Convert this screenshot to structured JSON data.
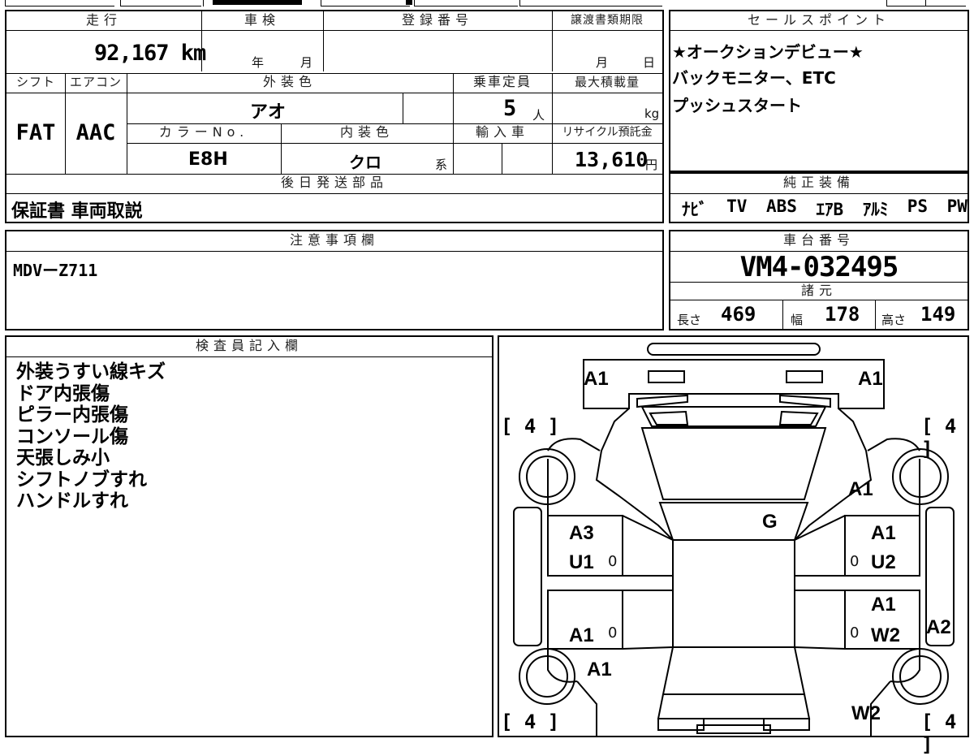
{
  "vehicle": {
    "mileage": "92,167 km",
    "inspection_year_unit": "年",
    "inspection_month_unit": "月",
    "transfer_month_unit": "月",
    "transfer_day_unit": "日",
    "shift": "FAT",
    "aircon": "AAC",
    "exterior_color": "アオ",
    "capacity": "5",
    "capacity_unit": "人",
    "max_load_unit": "kg",
    "color_no": "E8H",
    "interior_color": "クロ",
    "interior_suffix": "系",
    "recycle_fee": "13,610",
    "recycle_unit": "円",
    "chassis_no": "VM4-032495",
    "length_label": "長さ",
    "length": "469",
    "width_label": "幅",
    "width": "178",
    "height_label": "高さ",
    "height": "149"
  },
  "headers": {
    "mileage": "走行",
    "inspection": "車検",
    "registration": "登録番号",
    "transfer_deadline": "譲渡書類期限",
    "shift": "シフト",
    "aircon": "エアコン",
    "exterior_color": "外装色",
    "capacity": "乗車定員",
    "max_load": "最大積載量",
    "color_no": "カラーNo.",
    "interior_color": "内装色",
    "import": "輸入車",
    "recycle": "リサイクル預託金",
    "later_parts": "後日発送部品",
    "sales_points": "セールスポイント",
    "genuine_equipment": "純正装備",
    "notes": "注意事項欄",
    "chassis": "車台番号",
    "specs": "諸元",
    "inspector": "検査員記入欄"
  },
  "later_parts": "保証書 車両取説",
  "sales_points": [
    "★オークションデビュー★",
    "バックモニター、ETC",
    "プッシュスタート"
  ],
  "equipment": [
    "ﾅﾋﾞ",
    "TV",
    "ABS",
    "ｴｱB",
    "ｱﾙﾐ",
    "PS",
    "PW"
  ],
  "notes": "MDVーZ711",
  "inspector_notes": [
    "外装うすい線キズ",
    "ドア内張傷",
    "ピラー内張傷",
    "コンソール傷",
    "天張しみ小",
    "シフトノブすれ",
    "ハンドルすれ"
  ],
  "diagram": {
    "marks": {
      "front_left": "A1",
      "front_right": "A1",
      "right_fender": "A1",
      "roof": "G",
      "left_front_door": "A3",
      "left_front_door_2": "U1",
      "left_rear_door": "A1",
      "left_rear_fender": "A1",
      "right_front_door": "A1",
      "right_front_door_2": "U2",
      "right_rear_door": "A1",
      "right_rear_door_2": "W2",
      "right_rear_side": "A2",
      "rear_right": "W2"
    },
    "tires": {
      "front_left": "4",
      "front_right": "4",
      "rear_left": "4",
      "rear_right": "4"
    },
    "zero": "0"
  }
}
